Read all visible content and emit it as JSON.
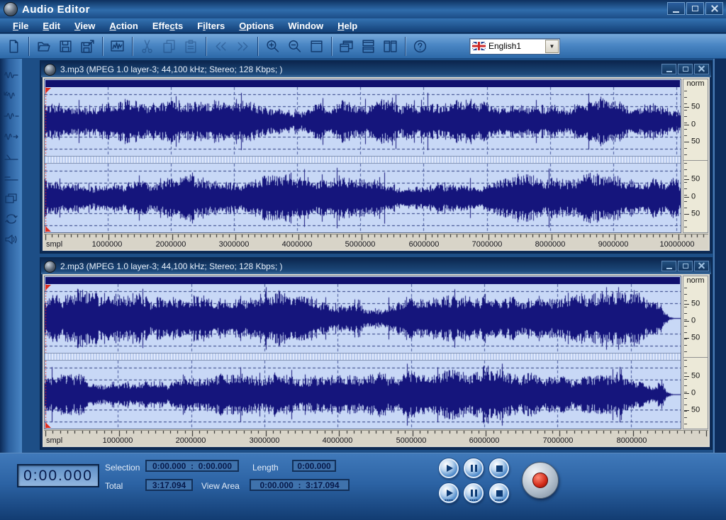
{
  "app": {
    "title": "Audio Editor"
  },
  "menu": [
    {
      "label": "File",
      "u": 0
    },
    {
      "label": "Edit",
      "u": 0
    },
    {
      "label": "View",
      "u": 0
    },
    {
      "label": "Action",
      "u": 0
    },
    {
      "label": "Effects",
      "u": 4
    },
    {
      "label": "Filters",
      "u": 1
    },
    {
      "label": "Options",
      "u": 0
    },
    {
      "label": "Window",
      "u": -1
    },
    {
      "label": "Help",
      "u": 0
    }
  ],
  "toolbar": {
    "groups": [
      [
        "new"
      ],
      [
        "open",
        "save",
        "save-as"
      ],
      [
        "waveform-view"
      ],
      [
        "cut",
        "copy",
        "paste"
      ],
      [
        "back",
        "forward"
      ],
      [
        "zoom-in",
        "zoom-out",
        "maximize-window"
      ],
      [
        "cascade-windows",
        "tile-horizontal",
        "tile-vertical"
      ],
      [
        "help"
      ]
    ],
    "disabled": [
      "cut",
      "copy",
      "paste",
      "back",
      "forward"
    ],
    "language": {
      "label": "English1",
      "flag": "uk-flag"
    }
  },
  "side_tools": [
    "wave-edit",
    "wave-shrink",
    "wave-stretch",
    "wave-forward",
    "level-line",
    "baseline",
    "copy-window",
    "loop-playback",
    "speaker"
  ],
  "documents": [
    {
      "title": "3.mp3 (MPEG 1.0 layer-3; 44,100 kHz; Stereo; 128 Kbps; )",
      "ruler_unit": "smpl",
      "ruler_labels": [
        "1000000",
        "2000000",
        "3000000",
        "4000000",
        "5000000",
        "6000000",
        "7000000",
        "8000000",
        "9000000",
        "10000000"
      ],
      "tick_fraction": 0.0993,
      "scale_label": "norm",
      "scale_marks": [
        "50",
        "0",
        "50"
      ],
      "wave": {
        "seed": 7,
        "end": 0.996
      }
    },
    {
      "title": "2.mp3 (MPEG 1.0 layer-3; 44,100 kHz; Stereo; 128 Kbps; )",
      "ruler_unit": "smpl",
      "ruler_labels": [
        "1000000",
        "2000000",
        "3000000",
        "4000000",
        "5000000",
        "6000000",
        "7000000",
        "8000000"
      ],
      "tick_fraction": 0.1152,
      "scale_label": "norm",
      "scale_marks": [
        "50",
        "0",
        "50"
      ],
      "wave": {
        "seed": 13,
        "end": 0.97
      }
    }
  ],
  "transport": {
    "time": "0:00.000",
    "selection_label": "Selection",
    "selection_value": "0:00.000  :  0:00.000",
    "length_label": "Length",
    "length_value": "0:00.000",
    "total_label": "Total",
    "total_value": "3:17.094",
    "view_area_label": "View Area",
    "view_area_value": "0:00.000  :  3:17.094",
    "buttons_row1": [
      "play",
      "pause",
      "stop"
    ],
    "buttons_row2": [
      "play-all",
      "pause-all",
      "stop-all"
    ],
    "record_button": "record"
  },
  "colors": {
    "wave_ink": "#15157c",
    "wave_bg": "#c8d8f6",
    "cursor_red": "#e03020",
    "accent_blue": "#2f6cab"
  }
}
